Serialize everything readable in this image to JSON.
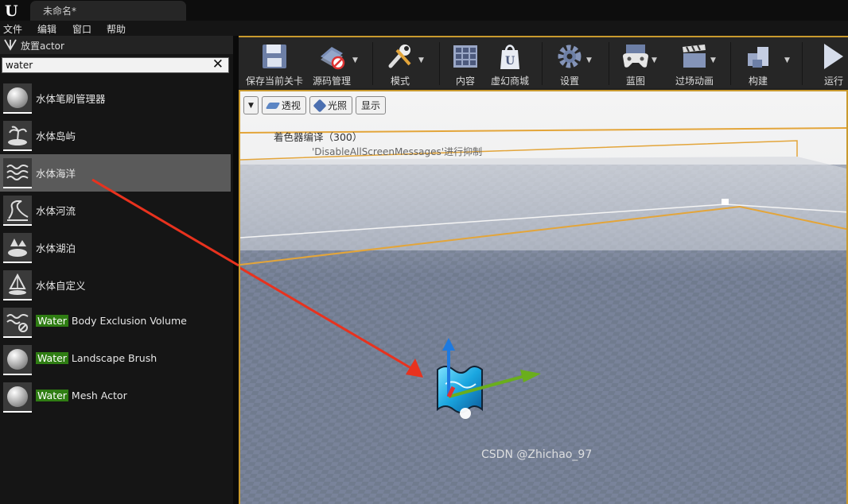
{
  "window": {
    "tab_title": "未命名*"
  },
  "menu": [
    "文件",
    "编辑",
    "窗口",
    "帮助"
  ],
  "panel": {
    "title": "放置actor",
    "search_value": "water",
    "items": [
      {
        "label": "水体笔刷管理器",
        "icon": "sphere-icon"
      },
      {
        "label": "水体岛屿",
        "icon": "island-icon"
      },
      {
        "label": "水体海洋",
        "icon": "ocean-wave-icon"
      },
      {
        "label": "水体河流",
        "icon": "river-icon"
      },
      {
        "label": "水体湖泊",
        "icon": "lake-icon"
      },
      {
        "label": "水体自定义",
        "icon": "custom-water-icon"
      },
      {
        "label_hl": "Water",
        "label_rest": " Body Exclusion Volume",
        "icon": "exclusion-volume-icon"
      },
      {
        "label_hl": "Water",
        "label_rest": " Landscape Brush",
        "icon": "sphere-icon"
      },
      {
        "label_hl": "Water",
        "label_rest": " Mesh Actor",
        "icon": "sphere-icon"
      }
    ],
    "selected_index": 2
  },
  "toolbar": {
    "save": "保存当前关卡",
    "source": "源码管理",
    "modes": "模式",
    "content": "内容",
    "marketplace": "虚幻商城",
    "settings": "设置",
    "blueprints": "蓝图",
    "cinematics": "过场动画",
    "build": "构建",
    "play": "运行"
  },
  "viewport": {
    "perspective": "透视",
    "lit": "光照",
    "show": "显示",
    "msg_shader": "着色器编译（300）",
    "msg_suppressed": "'DisableAllScreenMessages'进行抑制"
  },
  "watermark": "CSDN @Zhichao_97",
  "colors": {
    "accent": "#c99a2e",
    "highlight": "#2f7d13",
    "arrow": "#e8321e"
  }
}
